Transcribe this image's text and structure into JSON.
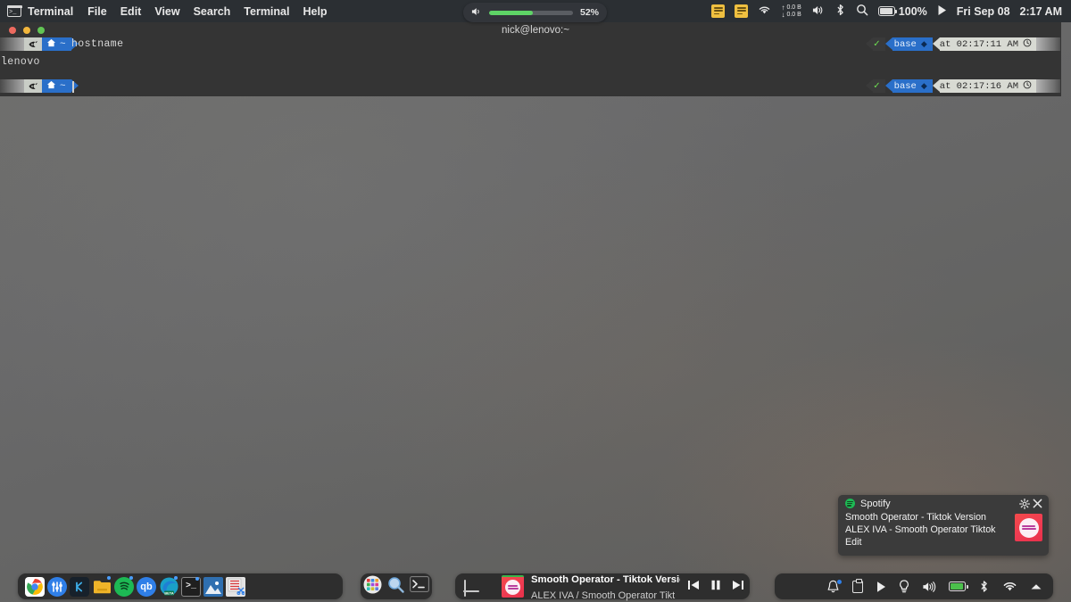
{
  "menubar": {
    "app_icon": "terminal-icon",
    "app_name": "Terminal",
    "items": [
      "File",
      "Edit",
      "View",
      "Search",
      "Terminal",
      "Help"
    ],
    "right": {
      "note_icon_1": "sticky-note-icon",
      "note_icon_2": "sticky-note-icon",
      "wifi_icon": "wifi-icon",
      "net_up_arrow": "↑",
      "net_down_arrow": "↓",
      "net_up_value": "0.0 B",
      "net_down_value": "0.0 B",
      "volume_icon": "volume-icon",
      "bluetooth_icon": "bluetooth-icon",
      "search_icon": "search-icon",
      "battery_icon": "battery-icon",
      "battery_label": "100%",
      "play_icon": "play-icon",
      "date": "Fri Sep 08",
      "time": "2:17 AM"
    }
  },
  "volume_osd": {
    "speaker_icon": "speaker-icon",
    "percent_label": "52%",
    "level": 52
  },
  "terminal": {
    "window_title": "nick@lenovo:~",
    "traffic_lights": [
      "close",
      "minimize",
      "maximize"
    ],
    "lines": [
      {
        "prompt_os_icon": "kali-dragon-icon",
        "prompt_path": "~",
        "prompt_home_icon": "home-icon",
        "command": "hostname",
        "right_status_icon": "✓",
        "right_env": "base",
        "right_env_badge": "◆",
        "right_time": "at 02:17:11 AM",
        "right_clock_icon": "clock-icon"
      },
      {
        "prompt_os_icon": "kali-dragon-icon",
        "prompt_path": "~",
        "prompt_home_icon": "home-icon",
        "command": "",
        "right_status_icon": "✓",
        "right_env": "base",
        "right_env_badge": "◆",
        "right_time": "at 02:17:16 AM",
        "right_clock_icon": "clock-icon"
      }
    ],
    "output": "lenovo"
  },
  "notification": {
    "app_name": "Spotify",
    "app_icon": "spotify-icon",
    "settings_icon": "gear-icon",
    "close_icon": "close-icon",
    "title": "Smooth Operator - Tiktok Version",
    "subtitle": "ALEX IVA - Smooth Operator Tiktok Edit",
    "album_art": "album-art"
  },
  "dock_main": {
    "icons": [
      {
        "name": "google-chrome",
        "glyph": "G",
        "bg": "#ffffff",
        "fg": "#4285f4",
        "running": false
      },
      {
        "name": "equalizer-app",
        "glyph": "⚙",
        "bg": "#2f7fe8",
        "fg": "#ffffff",
        "running": false
      },
      {
        "name": "kdenlive",
        "glyph": "K",
        "bg": "#1b2a38",
        "fg": "#3daee9",
        "running": false
      },
      {
        "name": "file-manager",
        "glyph": "",
        "bg": "#f0b429",
        "fg": "#6b4f00",
        "running": true
      },
      {
        "name": "spotify",
        "glyph": "",
        "bg": "#1db954",
        "fg": "#0a3d1d",
        "running": true
      },
      {
        "name": "qbittorrent",
        "glyph": "qb",
        "bg": "#2f7fe8",
        "fg": "#ffffff",
        "running": false
      },
      {
        "name": "microsoft-edge-beta",
        "glyph": "",
        "bg": "#1aa0c8",
        "fg": "#ffffff",
        "running": true
      },
      {
        "name": "terminal",
        "glyph": ">_",
        "bg": "#1f1f1f",
        "fg": "#e8e8e8",
        "running": true
      },
      {
        "name": "image-viewer",
        "glyph": "",
        "bg": "#2f6fb0",
        "fg": "#ffffff",
        "running": false
      },
      {
        "name": "screenshot-tool",
        "glyph": "",
        "bg": "#e8e8e8",
        "fg": "#d33",
        "running": false
      }
    ]
  },
  "dock_mini": {
    "icons": [
      {
        "name": "app-grid-icon"
      },
      {
        "name": "search-magnifier-icon"
      },
      {
        "name": "terminal-icon"
      }
    ]
  },
  "dock_media": {
    "display_icon": "laptop-display-icon",
    "album_art": "album-art",
    "track_title": "Smooth Operator - Tiktok Version",
    "track_artist": "ALEX IVA / Smooth Operator Tikt",
    "controls": [
      {
        "name": "previous-track-button",
        "glyph": "⏮"
      },
      {
        "name": "pause-button",
        "glyph": "⏸"
      },
      {
        "name": "next-track-button",
        "glyph": "⏭"
      }
    ]
  },
  "dock_tray": {
    "icons": [
      {
        "name": "notification-bell-icon",
        "badge": true
      },
      {
        "name": "clipboard-icon",
        "badge": false
      },
      {
        "name": "play-icon",
        "badge": false
      },
      {
        "name": "brightness-bulb-icon",
        "badge": false
      },
      {
        "name": "volume-icon",
        "badge": false
      },
      {
        "name": "battery-charging-icon",
        "badge": false
      },
      {
        "name": "bluetooth-icon",
        "badge": false
      },
      {
        "name": "wifi-icon",
        "badge": false
      },
      {
        "name": "show-hidden-icons-icon",
        "badge": false
      }
    ]
  },
  "colors": {
    "menubar_bg": "#2b2f33",
    "terminal_bg": "#343434",
    "accent_blue": "#2a6fc9",
    "spotify_green": "#1db954",
    "volume_green": "#5ed466",
    "dock_bg": "#2e2e2e"
  }
}
